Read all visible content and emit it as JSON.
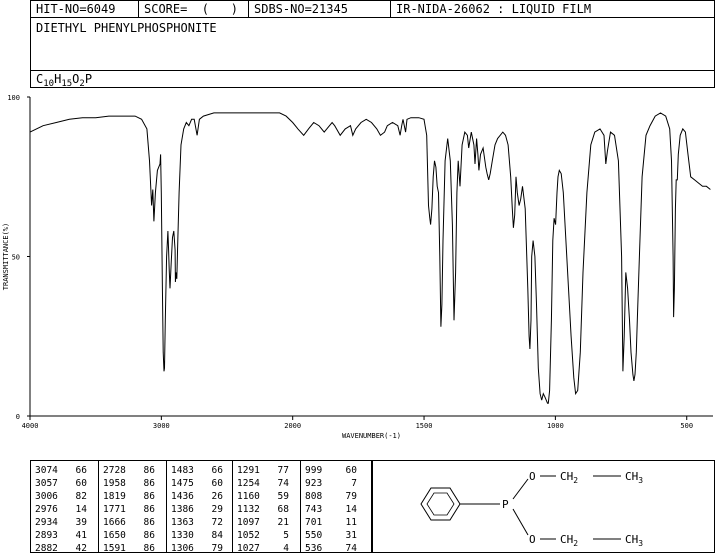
{
  "header": {
    "hit_no": "HIT-NO=6049",
    "score": "SCORE=  (   )",
    "sdbs_no": "SDBS-NO=21345",
    "ir_nida": "IR-NIDA-26062 : LIQUID FILM",
    "compound_name": "DIETHYL PHENYLPHOSPHONITE",
    "formula_parts": [
      {
        "text": "C",
        "sub": false
      },
      {
        "text": "10",
        "sub": true
      },
      {
        "text": "H",
        "sub": false
      },
      {
        "text": "15",
        "sub": true
      },
      {
        "text": "O",
        "sub": false
      },
      {
        "text": "2",
        "sub": true
      },
      {
        "text": "P",
        "sub": false
      }
    ]
  },
  "chart_data": {
    "type": "line",
    "xlabel": "WAVENUMBER(-1)",
    "ylabel": "TRANSMITTANCE(%)",
    "xlim": [
      4000,
      400
    ],
    "ylim": [
      0,
      100
    ],
    "x_ticks": [
      4000,
      3000,
      2000,
      1500,
      1000,
      500
    ],
    "y_ticks": [
      0,
      50,
      100
    ],
    "x_tick_labels": [
      "4000",
      "3000",
      "2000",
      "1500",
      "1000",
      "500"
    ],
    "y_tick_labels": [
      "0",
      "50",
      "100"
    ],
    "series": [
      {
        "points": [
          [
            4000,
            89
          ],
          [
            3900,
            91
          ],
          [
            3800,
            92
          ],
          [
            3700,
            93
          ],
          [
            3600,
            93.5
          ],
          [
            3500,
            93.5
          ],
          [
            3400,
            94
          ],
          [
            3300,
            94
          ],
          [
            3200,
            94
          ],
          [
            3150,
            93
          ],
          [
            3110,
            90
          ],
          [
            3090,
            80
          ],
          [
            3074,
            66
          ],
          [
            3065,
            71
          ],
          [
            3057,
            61
          ],
          [
            3045,
            70
          ],
          [
            3030,
            77
          ],
          [
            3020,
            78
          ],
          [
            3010,
            79
          ],
          [
            3006,
            82
          ],
          [
            3000,
            70
          ],
          [
            2992,
            40
          ],
          [
            2986,
            20
          ],
          [
            2980,
            14
          ],
          [
            2976,
            15
          ],
          [
            2970,
            30
          ],
          [
            2960,
            50
          ],
          [
            2950,
            58
          ],
          [
            2945,
            52
          ],
          [
            2940,
            46
          ],
          [
            2934,
            40
          ],
          [
            2925,
            48
          ],
          [
            2915,
            56
          ],
          [
            2905,
            58
          ],
          [
            2895,
            52
          ],
          [
            2893,
            42
          ],
          [
            2888,
            45
          ],
          [
            2882,
            43
          ],
          [
            2875,
            55
          ],
          [
            2865,
            70
          ],
          [
            2850,
            85
          ],
          [
            2830,
            90
          ],
          [
            2810,
            92
          ],
          [
            2790,
            91
          ],
          [
            2770,
            93
          ],
          [
            2750,
            93
          ],
          [
            2728,
            88
          ],
          [
            2710,
            93
          ],
          [
            2680,
            94
          ],
          [
            2600,
            95
          ],
          [
            2500,
            95
          ],
          [
            2400,
            95
          ],
          [
            2300,
            95
          ],
          [
            2200,
            95
          ],
          [
            2100,
            95
          ],
          [
            2050,
            94
          ],
          [
            2000,
            92
          ],
          [
            1980,
            90
          ],
          [
            1958,
            88
          ],
          [
            1940,
            90
          ],
          [
            1920,
            92
          ],
          [
            1900,
            91
          ],
          [
            1880,
            89
          ],
          [
            1870,
            90
          ],
          [
            1850,
            92
          ],
          [
            1840,
            91
          ],
          [
            1819,
            88
          ],
          [
            1800,
            90
          ],
          [
            1780,
            91
          ],
          [
            1771,
            88
          ],
          [
            1760,
            90
          ],
          [
            1740,
            92
          ],
          [
            1720,
            93
          ],
          [
            1700,
            92
          ],
          [
            1680,
            90
          ],
          [
            1666,
            88
          ],
          [
            1650,
            89
          ],
          [
            1640,
            91
          ],
          [
            1620,
            92
          ],
          [
            1600,
            91
          ],
          [
            1591,
            88
          ],
          [
            1585,
            91
          ],
          [
            1580,
            93
          ],
          [
            1570,
            89
          ],
          [
            1565,
            93
          ],
          [
            1550,
            93.5
          ],
          [
            1520,
            93.5
          ],
          [
            1500,
            93
          ],
          [
            1490,
            88
          ],
          [
            1483,
            66
          ],
          [
            1478,
            62
          ],
          [
            1475,
            60
          ],
          [
            1470,
            65
          ],
          [
            1465,
            75
          ],
          [
            1460,
            80
          ],
          [
            1455,
            78
          ],
          [
            1450,
            72
          ],
          [
            1445,
            70
          ],
          [
            1440,
            50
          ],
          [
            1436,
            28
          ],
          [
            1432,
            35
          ],
          [
            1428,
            55
          ],
          [
            1420,
            80
          ],
          [
            1410,
            87
          ],
          [
            1400,
            80
          ],
          [
            1392,
            60
          ],
          [
            1386,
            30
          ],
          [
            1380,
            45
          ],
          [
            1375,
            70
          ],
          [
            1370,
            80
          ],
          [
            1363,
            72
          ],
          [
            1355,
            85
          ],
          [
            1345,
            89
          ],
          [
            1335,
            88
          ],
          [
            1330,
            84
          ],
          [
            1320,
            89
          ],
          [
            1310,
            85
          ],
          [
            1306,
            79
          ],
          [
            1300,
            87
          ],
          [
            1295,
            82
          ],
          [
            1291,
            77
          ],
          [
            1285,
            82
          ],
          [
            1275,
            84
          ],
          [
            1265,
            78
          ],
          [
            1260,
            76
          ],
          [
            1254,
            74
          ],
          [
            1248,
            76
          ],
          [
            1240,
            80
          ],
          [
            1230,
            85
          ],
          [
            1220,
            87
          ],
          [
            1210,
            88
          ],
          [
            1200,
            89
          ],
          [
            1190,
            88
          ],
          [
            1180,
            85
          ],
          [
            1170,
            75
          ],
          [
            1164,
            65
          ],
          [
            1160,
            59
          ],
          [
            1155,
            63
          ],
          [
            1150,
            75
          ],
          [
            1145,
            70
          ],
          [
            1138,
            66
          ],
          [
            1132,
            68
          ],
          [
            1125,
            72
          ],
          [
            1115,
            65
          ],
          [
            1105,
            40
          ],
          [
            1100,
            25
          ],
          [
            1097,
            21
          ],
          [
            1093,
            30
          ],
          [
            1090,
            50
          ],
          [
            1085,
            55
          ],
          [
            1078,
            50
          ],
          [
            1072,
            35
          ],
          [
            1065,
            15
          ],
          [
            1058,
            7
          ],
          [
            1052,
            5
          ],
          [
            1046,
            7
          ],
          [
            1040,
            6
          ],
          [
            1035,
            5
          ],
          [
            1030,
            4
          ],
          [
            1027,
            4
          ],
          [
            1022,
            8
          ],
          [
            1015,
            30
          ],
          [
            1010,
            55
          ],
          [
            1005,
            62
          ],
          [
            999,
            60
          ],
          [
            994,
            70
          ],
          [
            990,
            75
          ],
          [
            985,
            77
          ],
          [
            978,
            76
          ],
          [
            970,
            70
          ],
          [
            960,
            55
          ],
          [
            950,
            40
          ],
          [
            940,
            25
          ],
          [
            930,
            12
          ],
          [
            923,
            7
          ],
          [
            915,
            8
          ],
          [
            905,
            20
          ],
          [
            895,
            45
          ],
          [
            880,
            70
          ],
          [
            865,
            85
          ],
          [
            850,
            89
          ],
          [
            830,
            90
          ],
          [
            815,
            88
          ],
          [
            808,
            79
          ],
          [
            802,
            83
          ],
          [
            790,
            89
          ],
          [
            775,
            88
          ],
          [
            760,
            80
          ],
          [
            748,
            50
          ],
          [
            743,
            14
          ],
          [
            738,
            25
          ],
          [
            732,
            45
          ],
          [
            725,
            40
          ],
          [
            718,
            30
          ],
          [
            712,
            20
          ],
          [
            705,
            13
          ],
          [
            701,
            11
          ],
          [
            697,
            13
          ],
          [
            692,
            20
          ],
          [
            688,
            30
          ],
          [
            680,
            50
          ],
          [
            670,
            75
          ],
          [
            655,
            88
          ],
          [
            640,
            91
          ],
          [
            620,
            94
          ],
          [
            600,
            95
          ],
          [
            580,
            94
          ],
          [
            565,
            90
          ],
          [
            558,
            80
          ],
          [
            552,
            50
          ],
          [
            550,
            31
          ],
          [
            547,
            40
          ],
          [
            543,
            65
          ],
          [
            540,
            74
          ],
          [
            536,
            74
          ],
          [
            532,
            82
          ],
          [
            525,
            88
          ],
          [
            515,
            90
          ],
          [
            505,
            89
          ],
          [
            495,
            82
          ],
          [
            485,
            75
          ],
          [
            470,
            74
          ],
          [
            455,
            73
          ],
          [
            440,
            72
          ],
          [
            425,
            72
          ],
          [
            410,
            71
          ]
        ]
      }
    ]
  },
  "peaks": [
    [
      {
        "wn": "3074",
        "t": "66"
      },
      {
        "wn": "3057",
        "t": "60"
      },
      {
        "wn": "3006",
        "t": "82"
      },
      {
        "wn": "2976",
        "t": "14"
      },
      {
        "wn": "2934",
        "t": "39"
      },
      {
        "wn": "2893",
        "t": "41"
      },
      {
        "wn": "2882",
        "t": "42"
      }
    ],
    [
      {
        "wn": "2728",
        "t": "86"
      },
      {
        "wn": "1958",
        "t": "86"
      },
      {
        "wn": "1819",
        "t": "86"
      },
      {
        "wn": "1771",
        "t": "86"
      },
      {
        "wn": "1666",
        "t": "86"
      },
      {
        "wn": "1650",
        "t": "86"
      },
      {
        "wn": "1591",
        "t": "86"
      }
    ],
    [
      {
        "wn": "1483",
        "t": "66"
      },
      {
        "wn": "1475",
        "t": "60"
      },
      {
        "wn": "1436",
        "t": "26"
      },
      {
        "wn": "1386",
        "t": "29"
      },
      {
        "wn": "1363",
        "t": "72"
      },
      {
        "wn": "1330",
        "t": "84"
      },
      {
        "wn": "1306",
        "t": "79"
      }
    ],
    [
      {
        "wn": "1291",
        "t": "77"
      },
      {
        "wn": "1254",
        "t": "74"
      },
      {
        "wn": "1160",
        "t": "59"
      },
      {
        "wn": "1132",
        "t": "68"
      },
      {
        "wn": "1097",
        "t": "21"
      },
      {
        "wn": "1052",
        "t": "5"
      },
      {
        "wn": "1027",
        "t": "4"
      }
    ],
    [
      {
        "wn": "999",
        "t": "60"
      },
      {
        "wn": "923",
        "t": "7"
      },
      {
        "wn": "808",
        "t": "79"
      },
      {
        "wn": "743",
        "t": "14"
      },
      {
        "wn": "701",
        "t": "11"
      },
      {
        "wn": "550",
        "t": "31"
      },
      {
        "wn": "536",
        "t": "74"
      }
    ]
  ],
  "structure": {
    "upper_o": "O",
    "upper_ch2": "CH",
    "upper_ch2_sub": "2",
    "upper_ch3": "CH",
    "upper_ch3_sub": "3",
    "p_atom": "P",
    "lower_o": "O",
    "lower_ch2": "CH",
    "lower_ch2_sub": "2",
    "lower_ch3": "CH",
    "lower_ch3_sub": "3"
  }
}
